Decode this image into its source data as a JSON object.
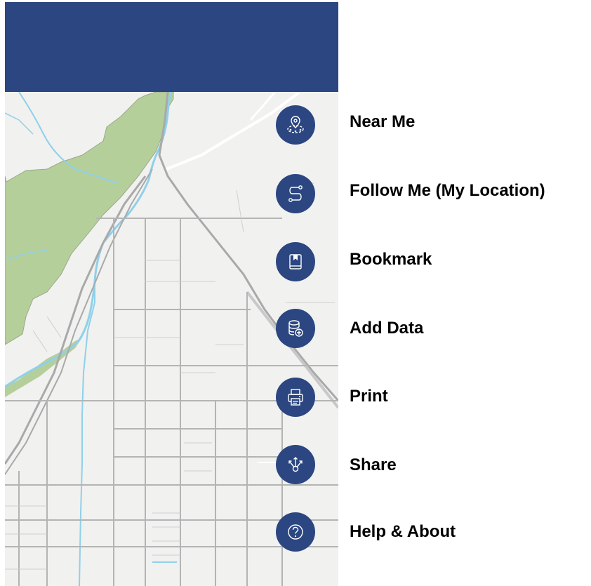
{
  "header": {
    "color": "#2b4680"
  },
  "map": {
    "background_color": "#f1f1f0",
    "park_color": "#b5cf9b",
    "water_color": "#8fd0ea",
    "road_color": "#a9a9a9"
  },
  "tools": [
    {
      "id": "near-me",
      "label": "Near Me",
      "icon": "map-pin-area-icon"
    },
    {
      "id": "follow-me",
      "label": "Follow Me (My Location)",
      "icon": "route-path-icon"
    },
    {
      "id": "bookmark",
      "label": "Bookmark",
      "icon": "bookmark-book-icon"
    },
    {
      "id": "add-data",
      "label": "Add Data",
      "icon": "database-add-icon"
    },
    {
      "id": "print",
      "label": "Print",
      "icon": "printer-icon"
    },
    {
      "id": "share",
      "label": "Share",
      "icon": "share-arrows-icon"
    },
    {
      "id": "help-about",
      "label": "Help & About",
      "icon": "question-circle-icon"
    }
  ]
}
